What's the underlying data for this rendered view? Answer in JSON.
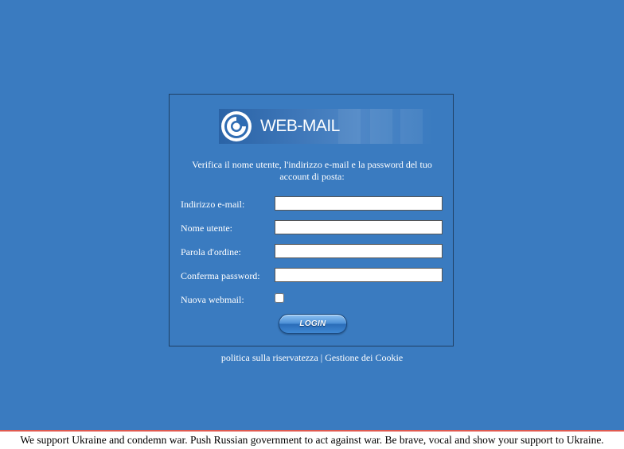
{
  "logo": {
    "text": "WEB-MAIL",
    "icon": "swirl-logo-icon"
  },
  "instructions": "Verifica il nome utente, l'indirizzo e-mail e la password del tuo account di posta:",
  "form": {
    "email_label": "Indirizzo e-mail:",
    "email_value": "",
    "username_label": "Nome utente:",
    "username_value": "",
    "password_label": "Parola d'ordine:",
    "password_value": "",
    "confirm_label": "Conferma password:",
    "confirm_value": "",
    "new_webmail_label": "Nuova webmail:",
    "new_webmail_checked": false
  },
  "login_button": "LOGIN",
  "footer": {
    "privacy_link": "politica sulla riservatezza",
    "separator": "|",
    "cookie_link": "Gestione dei Cookie"
  },
  "notice": "We support Ukraine and condemn war. Push Russian government to act against war. Be brave, vocal and show your support to Ukraine.",
  "colors": {
    "background": "#3a7bc0",
    "notice_border": "#e05a50"
  }
}
